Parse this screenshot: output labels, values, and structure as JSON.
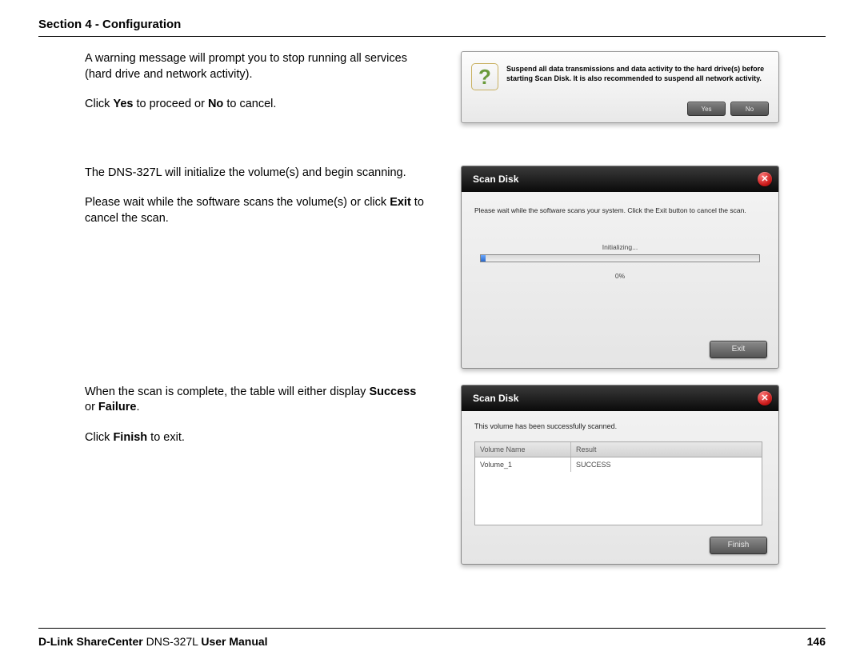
{
  "header": {
    "section": "Section 4 - Configuration"
  },
  "blocks": {
    "warn": {
      "p1": "A warning message will prompt you to stop running all services (hard drive and network activity).",
      "p2_pre": "Click ",
      "p2_yes": "Yes",
      "p2_mid": " to proceed or ",
      "p2_no": "No",
      "p2_post": " to cancel."
    },
    "scan": {
      "p1": "The DNS-327L will initialize the volume(s) and begin scanning.",
      "p2_pre": "Please wait while the software scans the volume(s) or click ",
      "p2_exit": "Exit",
      "p2_post": " to cancel the scan."
    },
    "result": {
      "p1_pre": "When the scan is complete, the table will either display ",
      "p1_success": "Success",
      "p1_mid": " or ",
      "p1_failure": "Failure",
      "p1_post": ".",
      "p2_pre": "Click ",
      "p2_finish": "Finish",
      "p2_post": " to exit."
    }
  },
  "dialog1": {
    "icon": "?",
    "text": "Suspend all data transmissions and data activity to the hard drive(s) before starting Scan Disk. It is also recommended to suspend all network activity.",
    "yes": "Yes",
    "no": "No"
  },
  "dialog2": {
    "title": "Scan Disk",
    "msg": "Please wait while the software scans your system. Click the Exit button to cancel the scan.",
    "initializing": "Initializing...",
    "percent": "0%",
    "exit": "Exit"
  },
  "dialog3": {
    "title": "Scan Disk",
    "msg": "This volume has been successfully scanned.",
    "col_volume": "Volume Name",
    "col_result": "Result",
    "row_volume": "Volume_1",
    "row_result": "SUCCESS",
    "finish": "Finish"
  },
  "footer": {
    "brand_bold1": "D-Link ShareCenter",
    "brand_light": " DNS-327L ",
    "brand_bold2": "User Manual",
    "page": "146"
  }
}
